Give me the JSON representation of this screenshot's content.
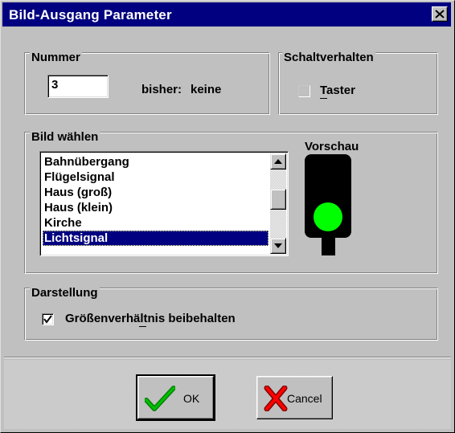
{
  "window": {
    "title": "Bild-Ausgang Parameter",
    "close_symbol": "×"
  },
  "nummer": {
    "group_label": "Nummer",
    "value": "3",
    "previous_label": "bisher:",
    "previous_value": "keine"
  },
  "schaltverhalten": {
    "group_label": "Schaltverhalten",
    "taster_label": "Taster",
    "taster_checked": false,
    "taster_enabled": false
  },
  "bild": {
    "group_label": "Bild wählen",
    "items": [
      "Bahnübergang",
      "Flügelsignal",
      "Haus (groß)",
      "Haus (klein)",
      "Kirche",
      "Lichtsignal"
    ],
    "selected_index": 5,
    "preview_label": "Vorschau",
    "preview_light_color": "#00ff00"
  },
  "darstellung": {
    "group_label": "Darstellung",
    "aspect_label": "Größenverhältnis beibehalten",
    "aspect_checked": true
  },
  "buttons": {
    "ok_label": "OK",
    "cancel_label": "Cancel"
  },
  "icons": {
    "close": "close-icon",
    "ok": "checkmark-icon",
    "cancel": "x-icon"
  },
  "colors": {
    "titlebar": "#000080",
    "selection": "#000080",
    "ok_check": "#00a000",
    "cancel_x": "#e00000"
  }
}
